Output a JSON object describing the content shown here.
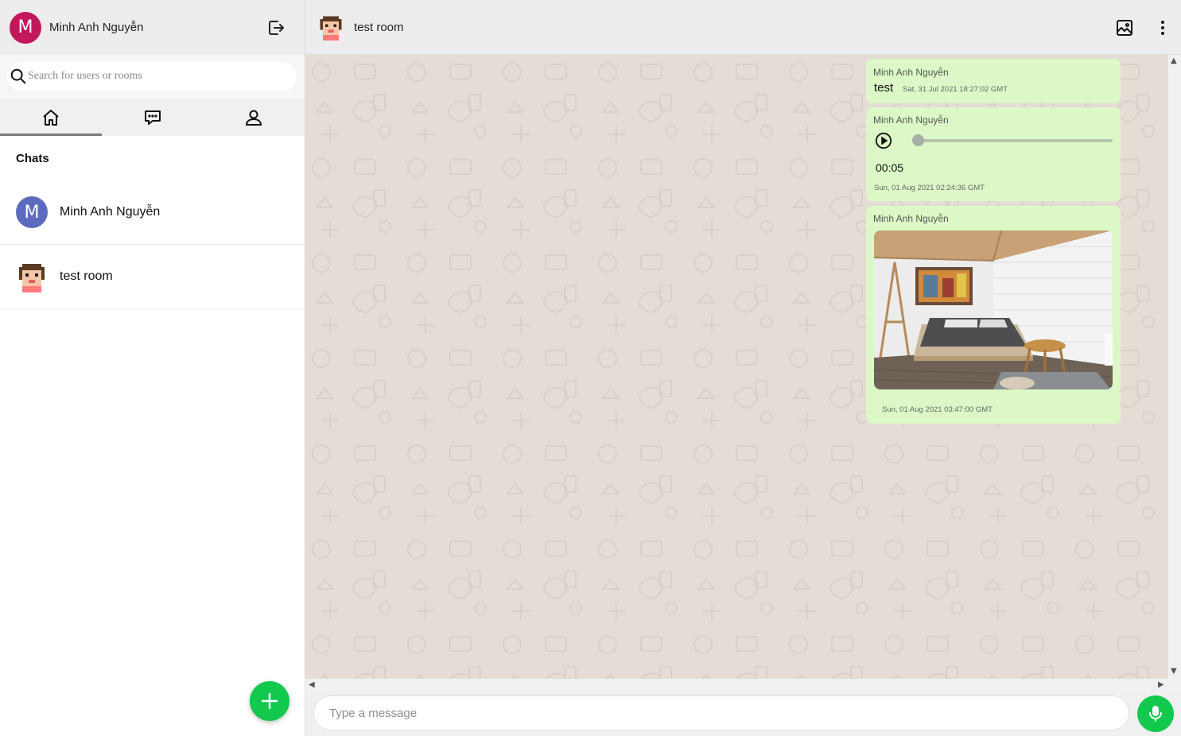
{
  "user": {
    "initial": "M",
    "name": "Minh Anh Nguyễn",
    "avatar_color": "#c2185b"
  },
  "search": {
    "placeholder": "Search for users or rooms"
  },
  "tabs": [
    {
      "icon": "home-icon",
      "active": true
    },
    {
      "icon": "chat-icon",
      "active": false
    },
    {
      "icon": "contacts-icon",
      "active": false
    }
  ],
  "chats": {
    "title": "Chats",
    "items": [
      {
        "name": "Minh Anh Nguyễn",
        "initial": "M",
        "avatar_color": "#5c6bc0"
      },
      {
        "name": "test room",
        "avatar": "pixel-face-avatar"
      }
    ]
  },
  "room": {
    "title": "test room"
  },
  "messages": [
    {
      "type": "text",
      "sender": "Minh Anh Nguyễn",
      "text": "test",
      "timestamp": "Sat, 31 Jul 2021 18:27:02 GMT"
    },
    {
      "type": "audio",
      "sender": "Minh Anh Nguyễn",
      "duration": "00:05",
      "progress": 0,
      "timestamp": "Sun, 01 Aug 2021 02:24:36 GMT"
    },
    {
      "type": "image",
      "sender": "Minh Anh Nguyễn",
      "image": "bedroom-photo",
      "timestamp": "Sun, 01 Aug 2021 03:47:00 GMT"
    }
  ],
  "composer": {
    "placeholder": "Type a message"
  },
  "colors": {
    "accent": "#12c94e",
    "bubble": "#dcf8c6",
    "chat_bg": "#e5ddd5"
  }
}
